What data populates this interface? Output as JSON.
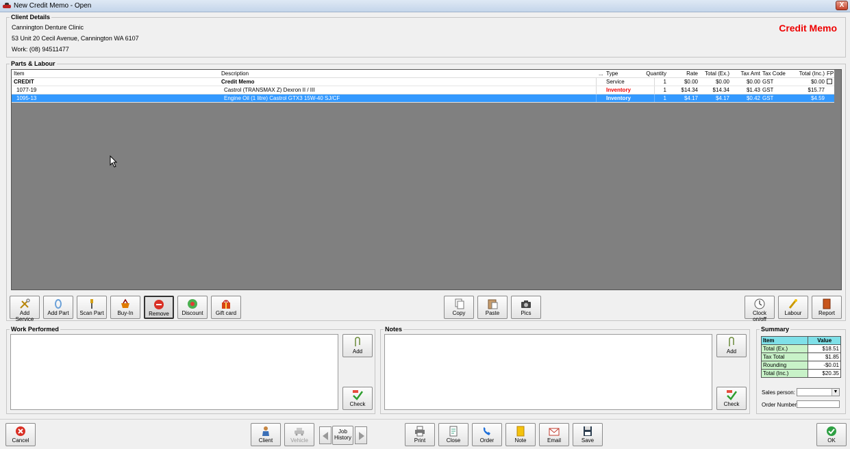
{
  "window": {
    "title": "New Credit Memo - Open",
    "close_glyph": "X"
  },
  "client": {
    "group_label": "Client Details",
    "name": "Cannington Denture Clinic",
    "address": "53 Unit 20 Cecil Avenue, Cannington  WA  6107",
    "work_phone": "Work: (08) 94511477",
    "doc_type": "Credit Memo"
  },
  "parts": {
    "group_label": "Parts & Labour",
    "columns": {
      "item": "Item",
      "description": "Description",
      "ellipsis": "...",
      "type": "Type",
      "quantity": "Quantity",
      "rate": "Rate",
      "total_ex": "Total (Ex.)",
      "tax_amt": "Tax Amt",
      "tax_code": "Tax Code",
      "total_inc": "Total (Inc.)",
      "fp": "FP"
    },
    "rows": [
      {
        "item": "CREDIT",
        "description": "Credit Memo",
        "type": "Service",
        "quantity": "1",
        "rate": "$0.00",
        "total_ex": "$0.00",
        "tax_amt": "$0.00",
        "tax_code": "GST",
        "total_inc": "$0.00"
      },
      {
        "item": "1077-19",
        "description": "Castrol (TRANSMAX Z) Dexron II / III",
        "type": "Inventory",
        "quantity": "1",
        "rate": "$14.34",
        "total_ex": "$14.34",
        "tax_amt": "$1.43",
        "tax_code": "GST",
        "total_inc": "$15.77"
      },
      {
        "item": "1095-13",
        "description": "Engine Oil (1 litre) Castrol GTX3 15W-40 SJ/CF",
        "type": "Inventory",
        "quantity": "1",
        "rate": "$4.17",
        "total_ex": "$4.17",
        "tax_amt": "$0.42",
        "tax_code": "GST",
        "total_inc": "$4.59"
      }
    ]
  },
  "toolbar": {
    "add_service": "Add Service",
    "add_part": "Add Part",
    "scan_part": "Scan Part",
    "buy_in": "Buy-In",
    "remove": "Remove",
    "discount": "Discount",
    "gift_card": "Gift card",
    "copy": "Copy",
    "paste": "Paste",
    "pics": "Pics",
    "clock": "Clock on/off",
    "labour": "Labour",
    "report": "Report"
  },
  "work": {
    "group_label": "Work Performed",
    "add": "Add",
    "check": "Check"
  },
  "notes": {
    "group_label": "Notes",
    "add": "Add",
    "check": "Check"
  },
  "summary": {
    "group_label": "Summary",
    "head_item": "Item",
    "head_value": "Value",
    "rows": [
      {
        "k": "Total (Ex.)",
        "v": "$18.51"
      },
      {
        "k": "Tax Total",
        "v": "$1.85"
      },
      {
        "k": "Rounding",
        "v": "-$0.01"
      },
      {
        "k": "Total (Inc.)",
        "v": "$20.35"
      }
    ],
    "sales_person_label": "Sales person:",
    "order_number_label": "Order Number:"
  },
  "bottom": {
    "cancel": "Cancel",
    "client": "Client",
    "vehicle": "Vehicle",
    "job_history": "Job History",
    "print": "Print",
    "close": "Close",
    "order": "Order",
    "note": "Note",
    "email": "Email",
    "save": "Save",
    "ok": "OK"
  },
  "colors": {
    "accent_red": "#e00000",
    "selection": "#3399ff",
    "grid_bg": "#808080",
    "summary_head": "#7fe0e8",
    "summary_key": "#c8f2c8"
  }
}
